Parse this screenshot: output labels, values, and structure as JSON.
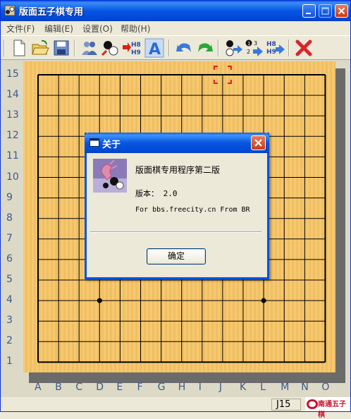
{
  "window": {
    "title": "版面五子棋专用"
  },
  "menu": {
    "items": [
      "文件(F)",
      "编辑(E)",
      "设置(O)",
      "帮助(H)"
    ]
  },
  "toolbar": {
    "buttons": [
      "new-file-icon",
      "open-folder-icon",
      "save-icon",
      "players-icon",
      "black-white-stones-icon",
      "h8h9-arrow-icon",
      "text-a-icon",
      "undo-arrow-icon",
      "redo-arrow-icon",
      "stone-arrow-icon",
      "numbered-stones-arrow-icon",
      "h8h9-forward-icon",
      "delete-x-icon"
    ],
    "h8_label": "H8",
    "h9_label": "H9",
    "a_label": "A",
    "num1": "1",
    "num2": "2",
    "num3": "3"
  },
  "board": {
    "row_labels": [
      "15",
      "14",
      "13",
      "12",
      "11",
      "10",
      "9",
      "8",
      "7",
      "6",
      "5",
      "4",
      "3",
      "2",
      "1"
    ],
    "col_labels": [
      "A",
      "B",
      "C",
      "D",
      "E",
      "F",
      "G",
      "H",
      "I",
      "J",
      "K",
      "L",
      "M",
      "N",
      "O"
    ],
    "star_points": [
      "D4",
      "L4"
    ],
    "cursor": "J15",
    "line_color": "#000000",
    "board_color": "#f7c566"
  },
  "status": {
    "position": "J15",
    "watermark": "南通五子棋"
  },
  "dialog": {
    "title": "关于",
    "app_name": "版面棋专用程序第二版",
    "version": "版本： 2.0",
    "credit": "For bbs.freecity.cn From BR",
    "ok_label": "确定"
  }
}
